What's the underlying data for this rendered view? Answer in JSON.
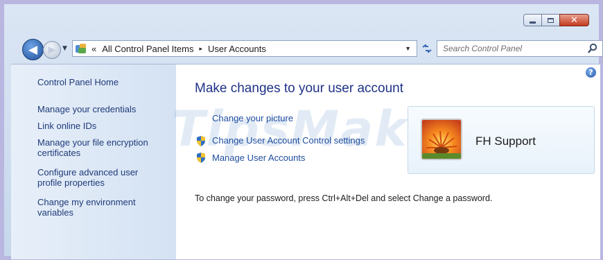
{
  "window": {
    "controls": {
      "minimize": "minimize",
      "maximize": "maximize",
      "close": "✕"
    }
  },
  "nav": {
    "address": {
      "chevron": "«",
      "crumb1": "All Control Panel Items",
      "separator": "▸",
      "crumb2": "User Accounts"
    },
    "search_placeholder": "Search Control Panel"
  },
  "sidebar": {
    "items": [
      {
        "label": "Control Panel Home"
      },
      {
        "label": "Manage your credentials"
      },
      {
        "label": "Link online IDs"
      },
      {
        "label": "Manage your file encryption certificates"
      },
      {
        "label": "Configure advanced user profile properties"
      },
      {
        "label": "Change my environment variables"
      }
    ]
  },
  "main": {
    "title": "Make changes to your user account",
    "links": [
      {
        "label": "Change your picture",
        "icon": "none"
      },
      {
        "label": "Change User Account Control settings",
        "icon": "uac-shield-icon"
      },
      {
        "label": "Manage User Accounts",
        "icon": "uac-shield-icon"
      }
    ],
    "password_note": "To change your password, press Ctrl+Alt+Del and select Change a password.",
    "user": {
      "name": "FH Support"
    },
    "watermark": "TipsMake"
  },
  "icons": {
    "back": "back-arrow-icon",
    "forward": "forward-arrow-icon",
    "refresh": "refresh-icon",
    "search": "search-icon",
    "help": "help-icon"
  },
  "colors": {
    "link": "#1d4c9e",
    "title": "#1e3287",
    "sidebar_bg": "#dce8f6",
    "close_button": "#c13a1e"
  }
}
